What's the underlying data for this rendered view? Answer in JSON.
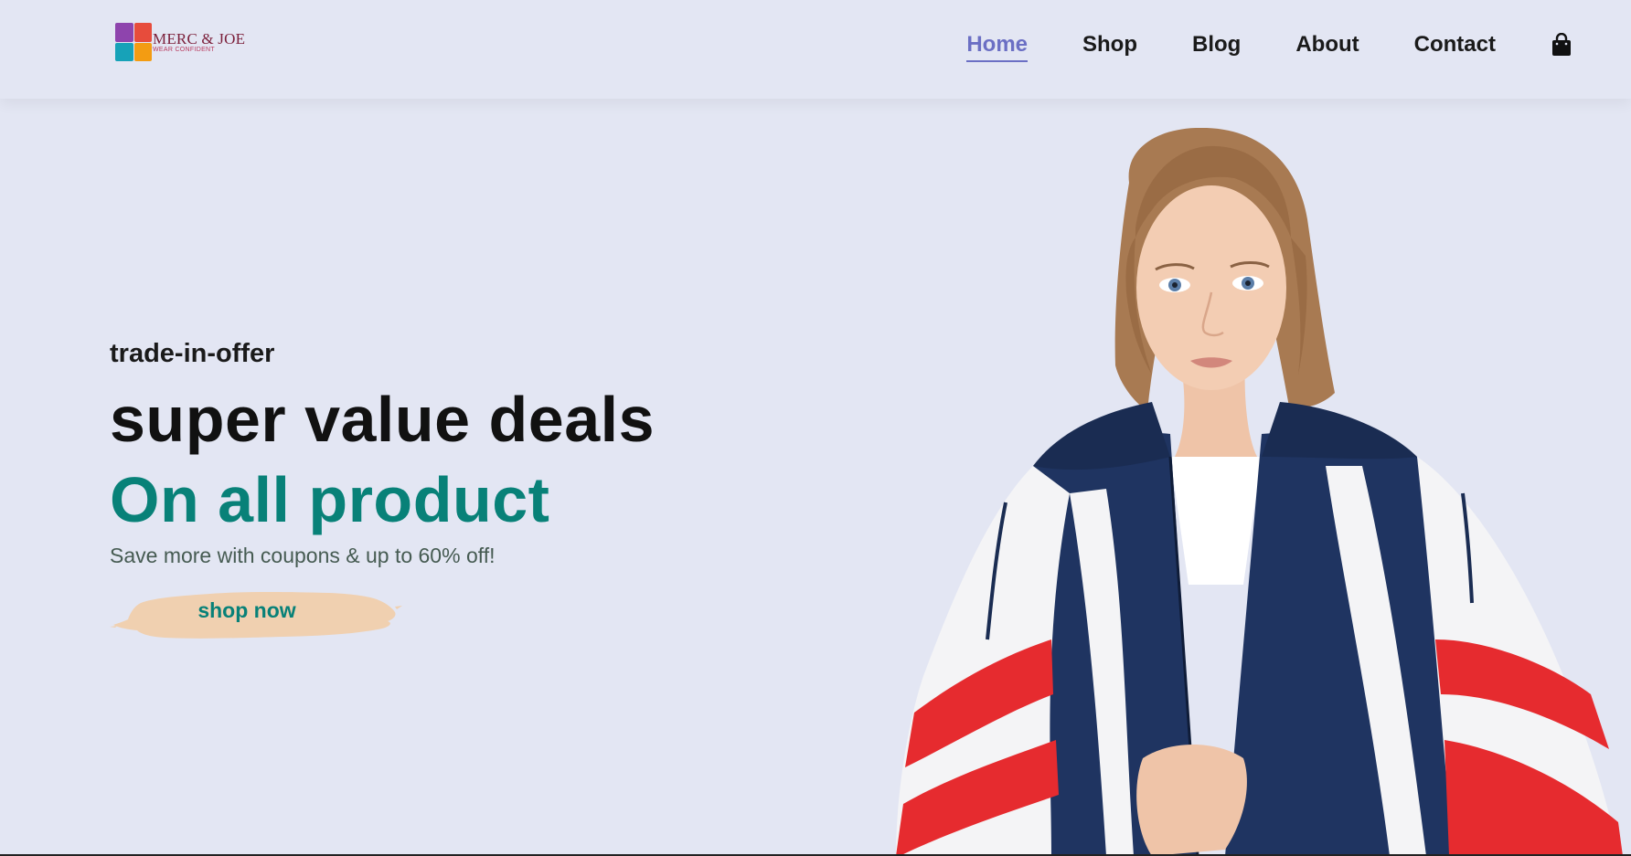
{
  "brand": {
    "name": "MERC & JOE",
    "tagline": "WEAR CONFIDENT",
    "colors": [
      "#8e44ad",
      "#e74c3c",
      "#17a2b8",
      "#f39c12"
    ]
  },
  "nav": {
    "items": [
      {
        "label": "Home",
        "active": true
      },
      {
        "label": "Shop",
        "active": false
      },
      {
        "label": "Blog",
        "active": false
      },
      {
        "label": "About",
        "active": false
      },
      {
        "label": "Contact",
        "active": false
      }
    ],
    "cart_icon": "shopping-bag-icon"
  },
  "hero": {
    "tagline": "trade-in-offer",
    "headline": "super value deals",
    "headline_accent": "On all product",
    "subtext": "Save more with coupons & up to 60% off!",
    "cta_label": "shop now"
  },
  "theme": {
    "background": "#e3e6f3",
    "accent": "#088178",
    "nav_active": "#6b6fc4",
    "button_bg": "#f0d0b0"
  }
}
